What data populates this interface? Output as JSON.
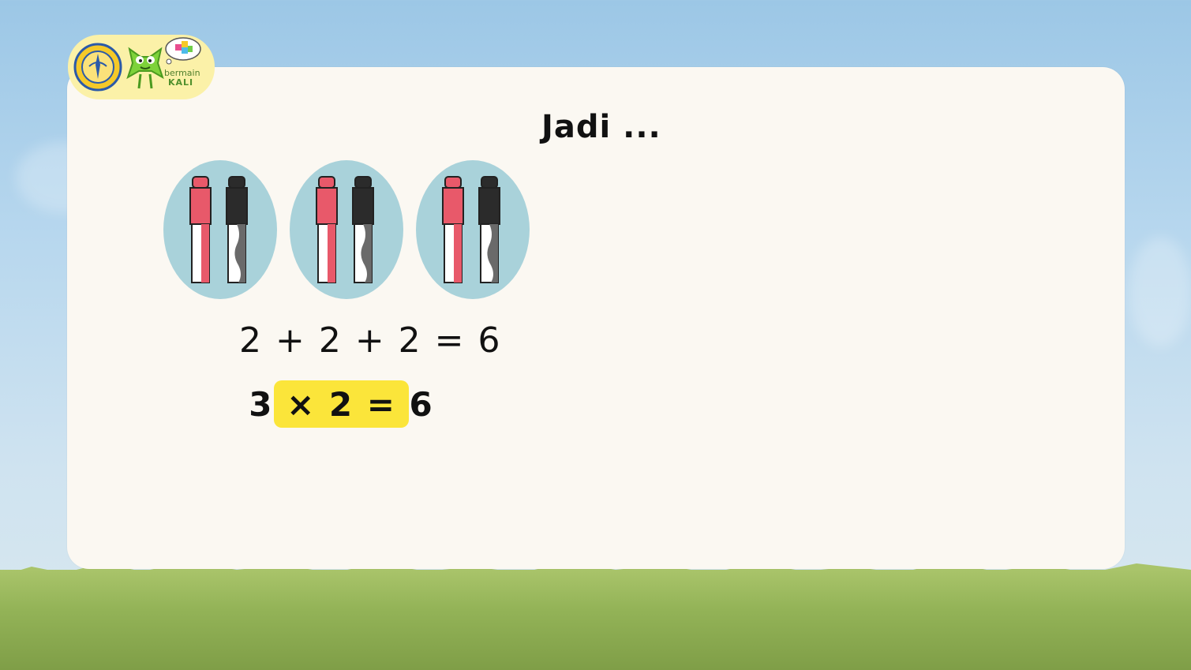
{
  "logo": {
    "line1": "bermain",
    "line2": "KALI",
    "emblem_icon": "university-emblem-icon",
    "mascot_icon": "green-multiply-mascot-icon",
    "thought_icon": "thought-bubble-blocks-icon"
  },
  "slide": {
    "title": "Jadi ...",
    "groups": [
      {
        "items": [
          "red-marker-icon",
          "black-marker-icon"
        ]
      },
      {
        "items": [
          "red-marker-icon",
          "black-marker-icon"
        ]
      },
      {
        "items": [
          "red-marker-icon",
          "black-marker-icon"
        ]
      }
    ],
    "addition": "2 + 2 + 2 = 6",
    "multiplication": "3 × 2 = 6"
  },
  "colors": {
    "highlight": "#fbe53a",
    "group_circle": "#a9d2da",
    "marker_red": "#e8596a",
    "marker_black": "#2b2b2b",
    "logo_pill": "#fbf1a8"
  }
}
